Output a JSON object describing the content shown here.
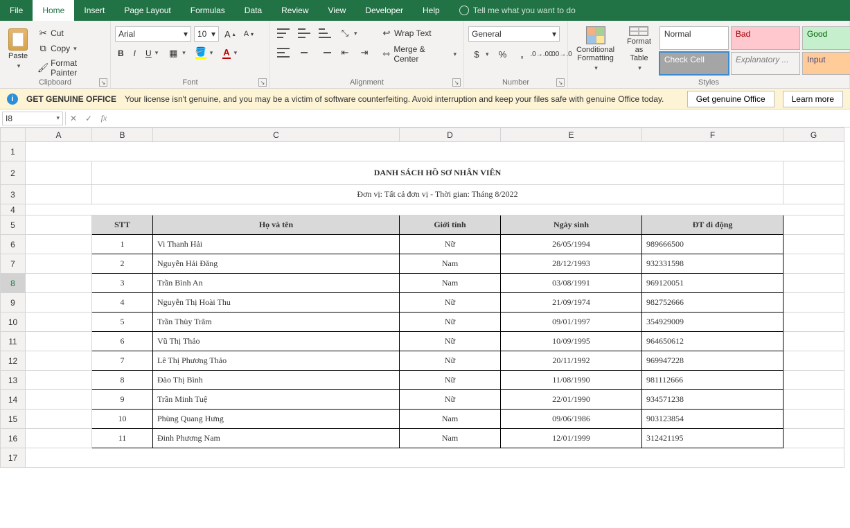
{
  "tabs": {
    "file": "File",
    "home": "Home",
    "insert": "Insert",
    "pageLayout": "Page Layout",
    "formulas": "Formulas",
    "data": "Data",
    "review": "Review",
    "view": "View",
    "developer": "Developer",
    "help": "Help",
    "tellMe": "Tell me what you want to do"
  },
  "clipboard": {
    "paste": "Paste",
    "cut": "Cut",
    "copy": "Copy",
    "formatPainter": "Format Painter",
    "group": "Clipboard"
  },
  "font": {
    "name": "Arial",
    "size": "10",
    "group": "Font"
  },
  "alignment": {
    "wrap": "Wrap Text",
    "merge": "Merge & Center",
    "group": "Alignment"
  },
  "number": {
    "format": "General",
    "group": "Number"
  },
  "stylesGrp": {
    "cond": "Conditional Formatting",
    "table": "Format as Table",
    "normal": "Normal",
    "bad": "Bad",
    "good": "Good",
    "check": "Check Cell",
    "expl": "Explanatory ...",
    "input": "Input",
    "group": "Styles"
  },
  "warning": {
    "title": "GET GENUINE OFFICE",
    "msg": "Your license isn't genuine, and you may be a victim of software counterfeiting. Avoid interruption and keep your files safe with genuine Office today.",
    "btn1": "Get genuine Office",
    "btn2": "Learn more"
  },
  "refbar": {
    "cell": "I8",
    "formula": ""
  },
  "columns": [
    "A",
    "B",
    "C",
    "D",
    "E",
    "F",
    "G"
  ],
  "sheet": {
    "title": "DANH SÁCH HỒ SƠ NHÂN VIÊN",
    "subtitle": "Đơn vị: Tất cả đơn vị - Thời gian: Tháng 8/2022",
    "headers": {
      "stt": "STT",
      "name": "Họ và tên",
      "gender": "Giới tính",
      "dob": "Ngày sinh",
      "phone": "ĐT di động"
    },
    "rows": [
      {
        "stt": "1",
        "name": "Vi Thanh Hải",
        "gender": "Nữ",
        "dob": "26/05/1994",
        "phone": "989666500"
      },
      {
        "stt": "2",
        "name": "Nguyễn Hải Đăng",
        "gender": "Nam",
        "dob": "28/12/1993",
        "phone": "932331598"
      },
      {
        "stt": "3",
        "name": "Trần Bình An",
        "gender": "Nam",
        "dob": "03/08/1991",
        "phone": "969120051"
      },
      {
        "stt": "4",
        "name": "Nguyễn Thị Hoài Thu",
        "gender": "Nữ",
        "dob": "21/09/1974",
        "phone": "982752666"
      },
      {
        "stt": "5",
        "name": "Trần Thùy Trâm",
        "gender": "Nữ",
        "dob": "09/01/1997",
        "phone": "354929009"
      },
      {
        "stt": "6",
        "name": "Vũ Thị Thảo",
        "gender": "Nữ",
        "dob": "10/09/1995",
        "phone": "964650612"
      },
      {
        "stt": "7",
        "name": "Lê Thị Phương Thảo",
        "gender": "Nữ",
        "dob": "20/11/1992",
        "phone": "969947228"
      },
      {
        "stt": "8",
        "name": "Đào Thị Bình",
        "gender": "Nữ",
        "dob": "11/08/1990",
        "phone": "981112666"
      },
      {
        "stt": "9",
        "name": "Trần Minh Tuệ",
        "gender": "Nữ",
        "dob": "22/01/1990",
        "phone": "934571238"
      },
      {
        "stt": "10",
        "name": "Phùng Quang Hưng",
        "gender": "Nam",
        "dob": "09/06/1986",
        "phone": "903123854"
      },
      {
        "stt": "11",
        "name": "Đinh Phương Nam",
        "gender": "Nam",
        "dob": "12/01/1999",
        "phone": "312421195"
      }
    ]
  }
}
